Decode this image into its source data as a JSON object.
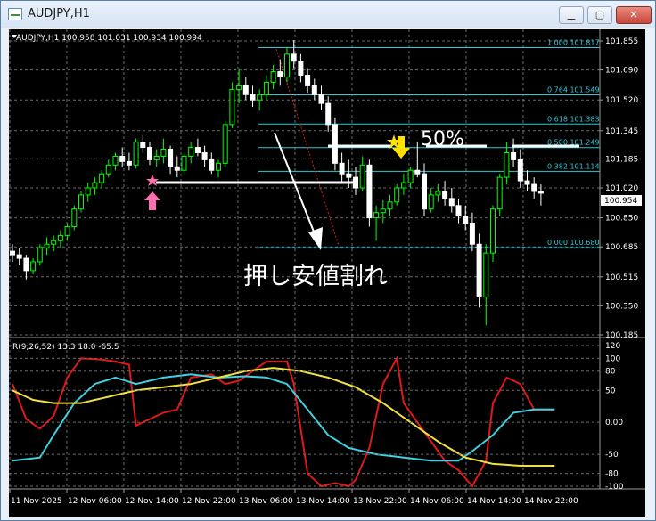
{
  "window": {
    "title": "AUDJPY,H1",
    "minimize": "▁",
    "maximize": "▢",
    "close": "✕"
  },
  "main": {
    "info": "AUDJPY,H1  100.958 101.031 100.934 100.994",
    "price_ticks": [
      "101.855",
      "101.690",
      "101.520",
      "101.345",
      "101.185",
      "101.020",
      "100.850",
      "100.685",
      "100.515",
      "100.350",
      "100.185"
    ],
    "current_price": "100.954",
    "fib_levels": [
      {
        "label": "1.000  101.817",
        "price": 101.817
      },
      {
        "label": "0.764  101.549",
        "price": 101.549
      },
      {
        "label": "0.618  101.383",
        "price": 101.383
      },
      {
        "label": "0.500  101.249",
        "price": 101.249
      },
      {
        "label": "0.382  101.114",
        "price": 101.114
      },
      {
        "label": "0.000  100.680",
        "price": 100.68
      }
    ],
    "annotation_50": "50%",
    "annotation_break": "押し安値割れ"
  },
  "sub": {
    "info": "R(9,26,52) 13.3 18.0 -65.5",
    "ticks": [
      "120",
      "100",
      "80",
      "50",
      "0.00",
      "-50",
      "-80",
      "-100"
    ]
  },
  "time_axis": [
    "11 Nov 2025",
    "12 Nov 06:00",
    "12 Nov 14:00",
    "12 Nov 22:00",
    "13 Nov 06:00",
    "13 Nov 14:00",
    "13 Nov 22:00",
    "14 Nov 06:00",
    "14 Nov 14:00",
    "14 Nov 22:00"
  ],
  "colors": {
    "bull": "#00ff00",
    "bear": "#ffffff",
    "fib": "#30c8d8",
    "red": "#e01818",
    "cyan": "#40d0e0",
    "yellow": "#f0e040"
  }
}
